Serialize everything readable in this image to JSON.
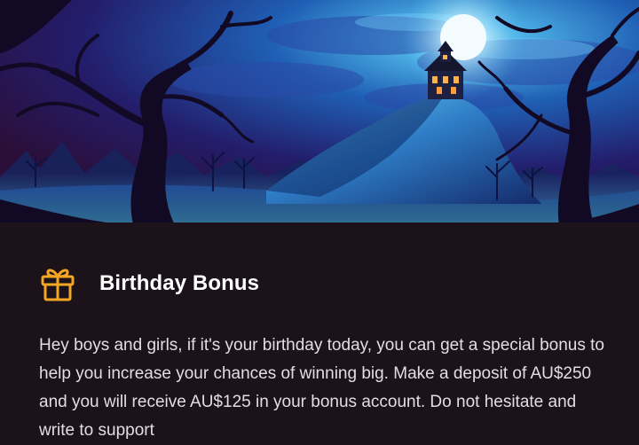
{
  "banner": {
    "image_alt": "haunted-house-night-illustration"
  },
  "bonus": {
    "icon": "gift-icon",
    "icon_color": "#f5a623",
    "title": "Birthday Bonus",
    "description": "Hey boys and girls, if it's your birthday today, you can get a special bonus to help you increase your chances of winning big. Make a deposit of AU$250 and you will receive AU$125 in your bonus account. Do not hesitate and write to support"
  },
  "colors": {
    "background": "#1c1219",
    "title_text": "#ffffff",
    "body_text": "#e3dde2"
  }
}
